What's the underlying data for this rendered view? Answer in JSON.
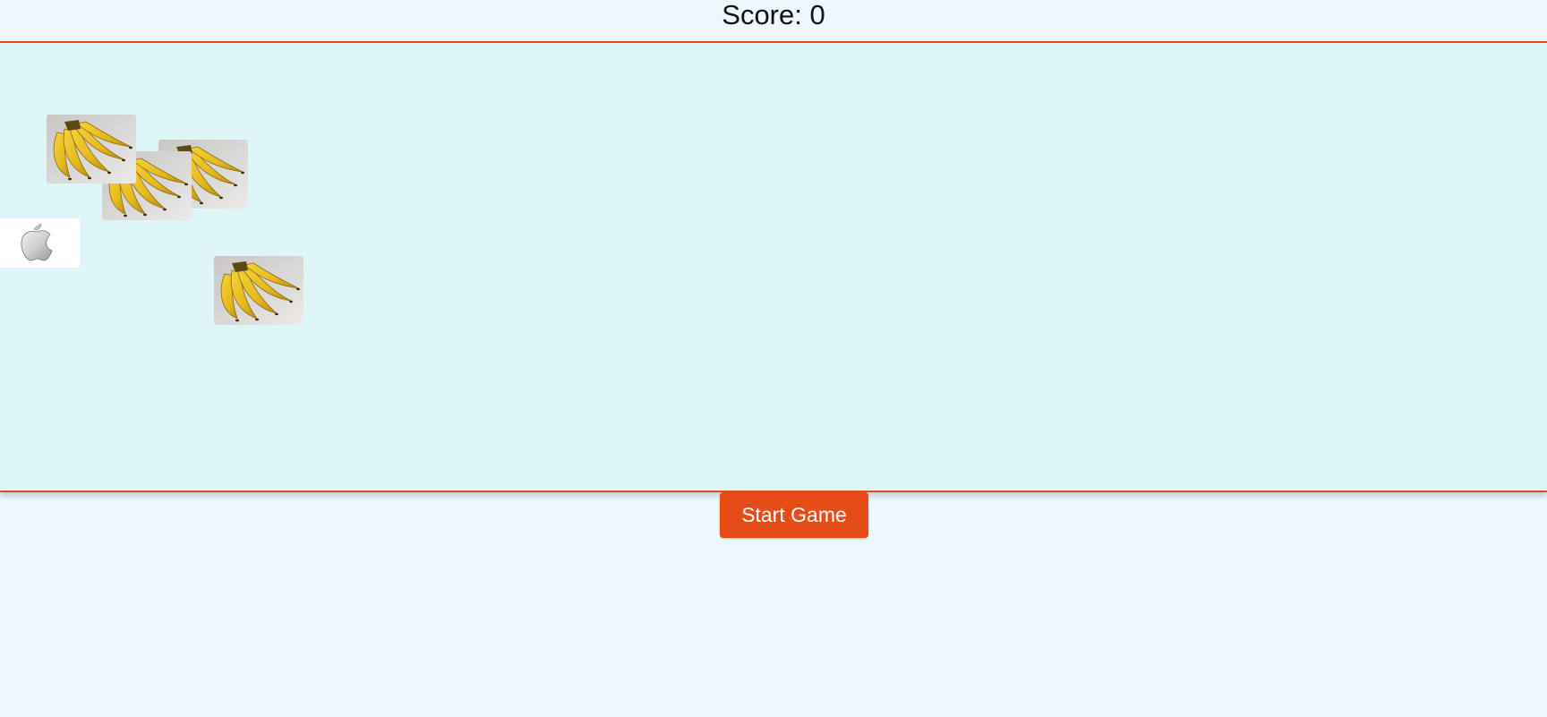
{
  "header": {
    "score_label": "Score: 0"
  },
  "play_area": {
    "background": "#dff6f8",
    "border_color": "#e2491b",
    "fruits": [
      {
        "kind": "banana",
        "icon": "banana-bunch-icon"
      },
      {
        "kind": "banana",
        "icon": "banana-bunch-icon"
      },
      {
        "kind": "banana",
        "icon": "banana-bunch-icon"
      },
      {
        "kind": "banana",
        "icon": "banana-bunch-icon"
      },
      {
        "kind": "apple",
        "icon": "apple-logo-icon"
      }
    ]
  },
  "controls": {
    "start_label": "Start Game",
    "start_color": "#e64c17"
  }
}
